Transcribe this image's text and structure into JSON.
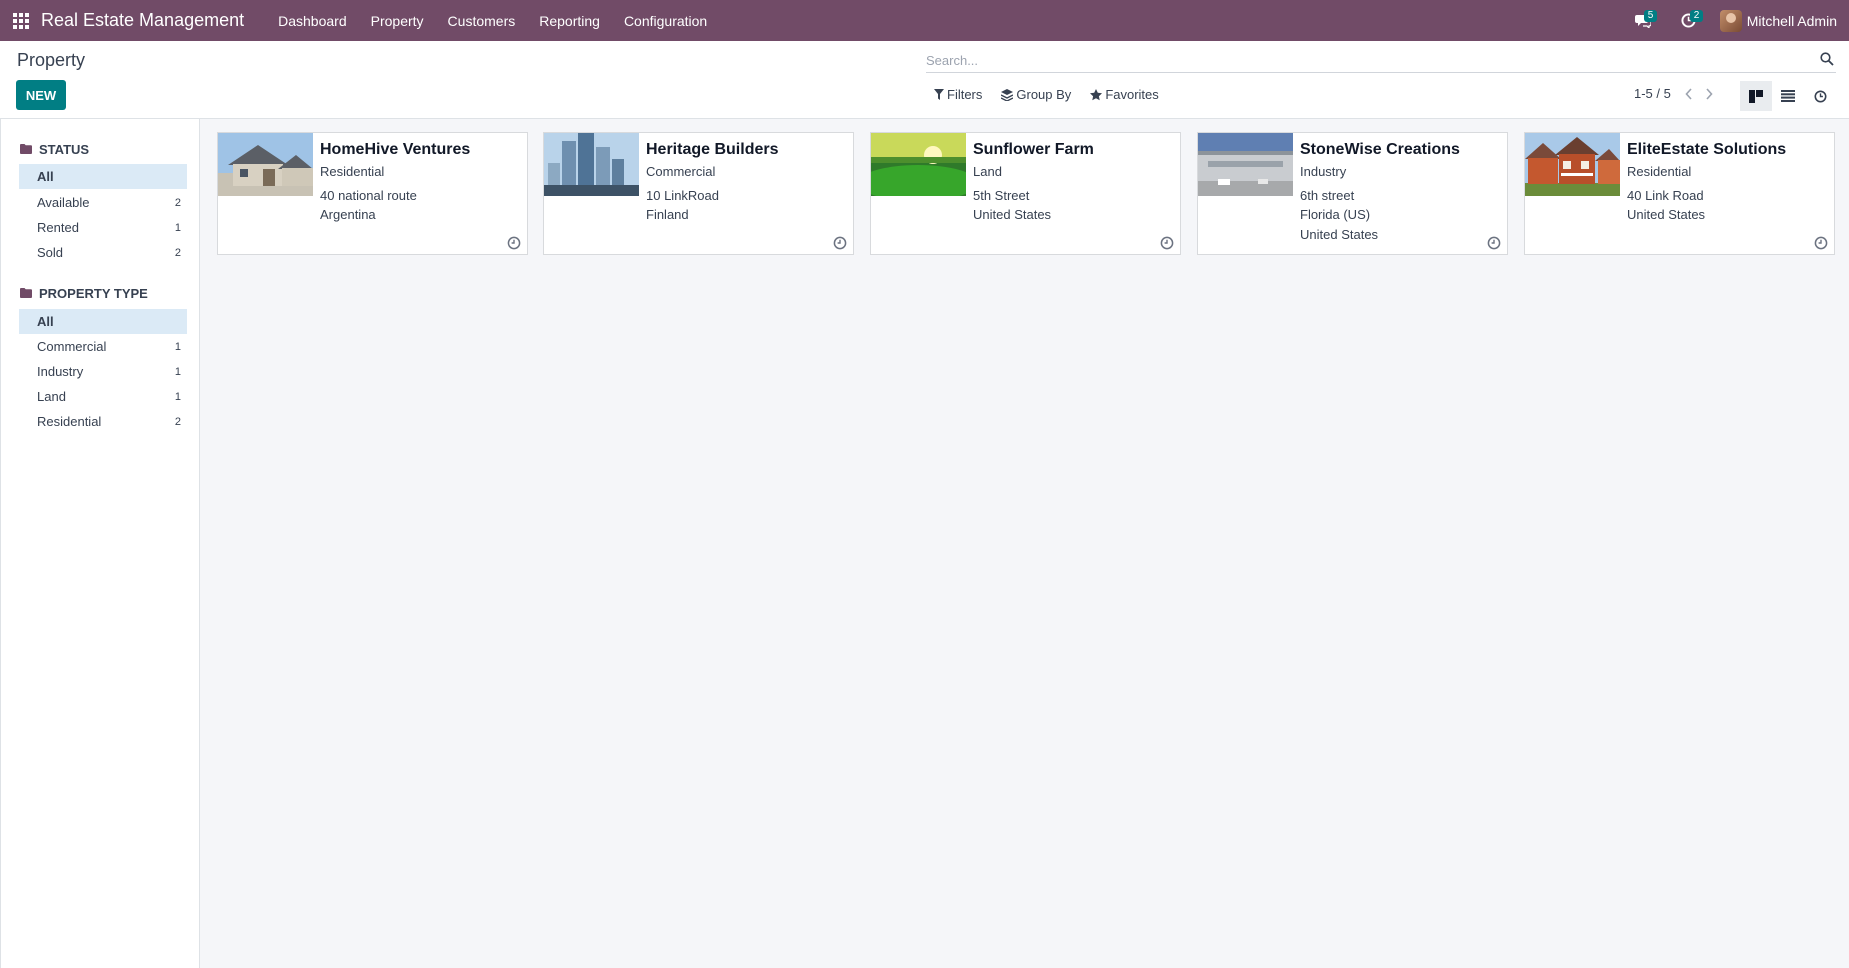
{
  "navbar": {
    "app_name": "Real Estate Management",
    "menu": [
      "Dashboard",
      "Property",
      "Customers",
      "Reporting",
      "Configuration"
    ],
    "messages_count": "5",
    "activities_count": "2",
    "user_name": "Mitchell Admin"
  },
  "control_panel": {
    "title": "Property",
    "new_label": "NEW",
    "search_placeholder": "Search...",
    "filters_label": "Filters",
    "groupby_label": "Group By",
    "favorites_label": "Favorites",
    "pager": "1-5 / 5"
  },
  "sidebar": {
    "status": {
      "heading": "STATUS",
      "items": [
        {
          "label": "All",
          "count": ""
        },
        {
          "label": "Available",
          "count": "2"
        },
        {
          "label": "Rented",
          "count": "1"
        },
        {
          "label": "Sold",
          "count": "2"
        }
      ]
    },
    "property_type": {
      "heading": "PROPERTY TYPE",
      "items": [
        {
          "label": "All",
          "count": ""
        },
        {
          "label": "Commercial",
          "count": "1"
        },
        {
          "label": "Industry",
          "count": "1"
        },
        {
          "label": "Land",
          "count": "1"
        },
        {
          "label": "Residential",
          "count": "2"
        }
      ]
    }
  },
  "cards": [
    {
      "name": "HomeHive Ventures",
      "type": "Residential",
      "address": [
        "40 national route",
        "Argentina"
      ]
    },
    {
      "name": "Heritage Builders",
      "type": "Commercial",
      "address": [
        "10 LinkRoad",
        "Finland"
      ]
    },
    {
      "name": "Sunflower Farm",
      "type": "Land",
      "address": [
        "5th Street",
        "United States"
      ]
    },
    {
      "name": "StoneWise Creations",
      "type": "Industry",
      "address": [
        "6th street",
        "Florida (US)",
        "United States"
      ]
    },
    {
      "name": "EliteEstate Solutions",
      "type": "Residential",
      "address": [
        "40 Link Road",
        "United States"
      ]
    }
  ],
  "colors": {
    "navbar": "#714b67",
    "primary": "#017e84",
    "active_facet": "#dbeaf6"
  }
}
